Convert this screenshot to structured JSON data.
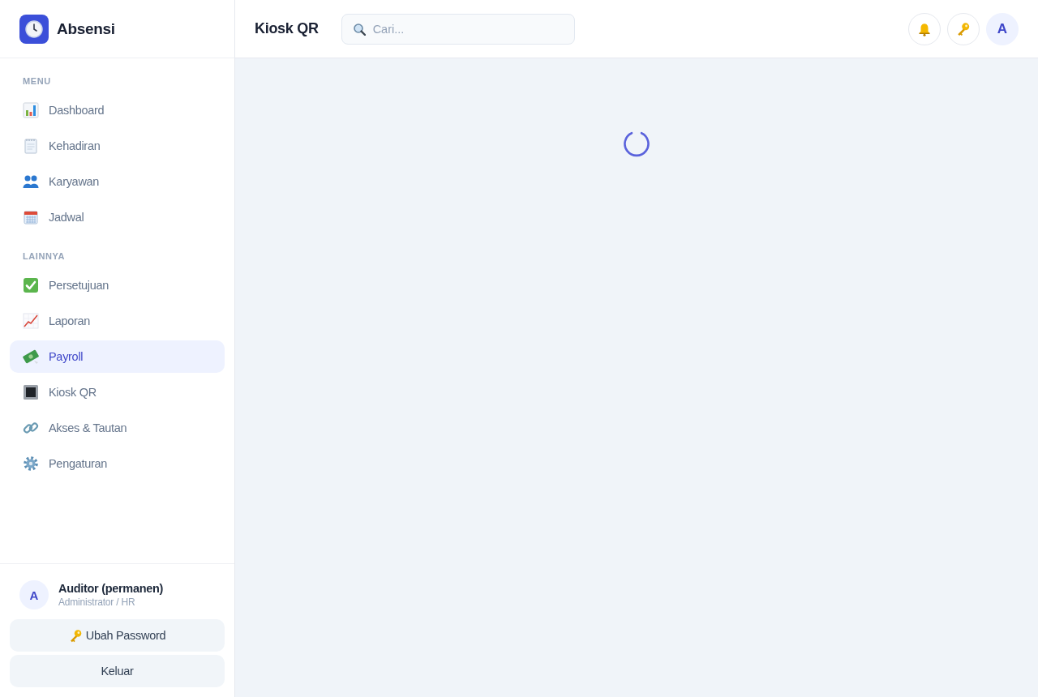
{
  "sidebar": {
    "brand": {
      "name": "Absensi"
    },
    "sections": [
      {
        "label": "MENU",
        "items": [
          {
            "label": "Dashboard",
            "selected": false
          },
          {
            "label": "Kehadiran",
            "selected": false
          },
          {
            "label": "Karyawan",
            "selected": false
          },
          {
            "label": "Jadwal",
            "selected": false
          }
        ]
      },
      {
        "label": "LAINNYA",
        "items": [
          {
            "label": "Persetujuan",
            "selected": false
          },
          {
            "label": "Laporan",
            "selected": false
          },
          {
            "label": "Payroll",
            "selected": true
          },
          {
            "label": "Kiosk QR",
            "selected": false
          },
          {
            "label": "Akses & Tautan",
            "selected": false
          },
          {
            "label": "Pengaturan",
            "selected": false
          }
        ]
      }
    ],
    "user": {
      "initial": "A",
      "name": "Auditor (permanen)",
      "role": "Administrator / HR"
    },
    "buttons": [
      {
        "kind": "key",
        "label": "Ubah Password"
      },
      {
        "kind": "plain",
        "label": "Keluar"
      }
    ]
  },
  "header": {
    "title": "Kiosk QR",
    "search": {
      "placeholder": "Cari..."
    },
    "actions": [
      {
        "kind": "bell"
      },
      {
        "kind": "key"
      },
      {
        "kind": "avatar",
        "label": "A"
      }
    ]
  },
  "content": {
    "loading": true
  }
}
